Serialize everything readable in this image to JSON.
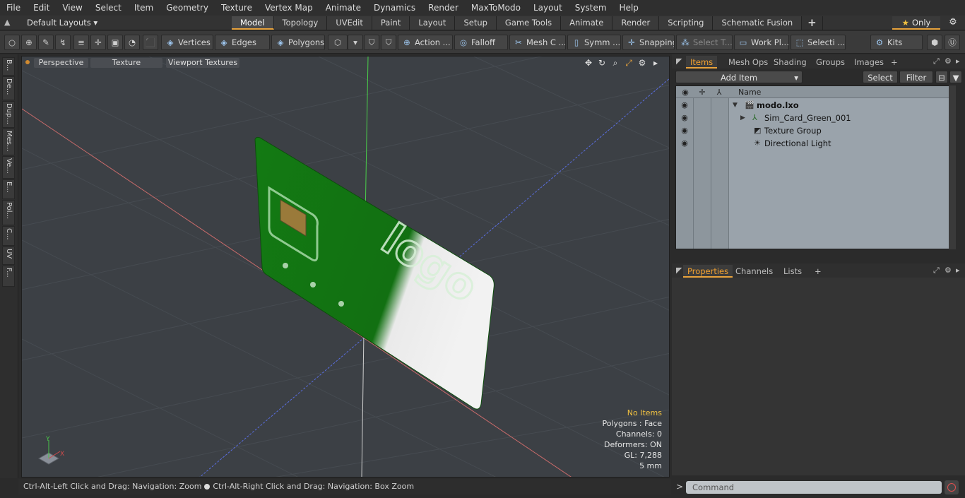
{
  "menu": [
    "File",
    "Edit",
    "View",
    "Select",
    "Item",
    "Geometry",
    "Texture",
    "Vertex Map",
    "Animate",
    "Dynamics",
    "Render",
    "MaxToModo",
    "Layout",
    "System",
    "Help"
  ],
  "layout": {
    "selector": "Default Layouts ▾",
    "tabs": [
      "Model",
      "Topology",
      "UVEdit",
      "Paint",
      "Layout",
      "Setup",
      "Game Tools",
      "Animate",
      "Render",
      "Scripting",
      "Schematic Fusion"
    ],
    "active_tab": "Model",
    "plus": "+",
    "only": "Only"
  },
  "toolbar": {
    "vertices": "Vertices",
    "edges": "Edges",
    "polygons": "Polygons",
    "action": "Action ...",
    "falloff": "Falloff",
    "mesh": "Mesh C ...",
    "symm": "Symm ...",
    "snapping": "Snapping",
    "select_t": "Select T...",
    "work_pl": "Work Pl...",
    "selecti": "Selecti ...",
    "kits": "Kits"
  },
  "left_tabs": [
    "B...",
    "De...",
    "Dup...",
    "Mes...",
    "Ve...",
    "E...",
    "Pol...",
    "C...",
    "UV",
    "F..."
  ],
  "viewport": {
    "perspective": "Perspective",
    "texture": "Texture",
    "viewport_textures": "Viewport Textures",
    "card_logo": "logo",
    "info": {
      "no_items": "No Items",
      "polygons": "Polygons : Face",
      "channels": "Channels: 0",
      "deformers": "Deformers: ON",
      "gl": "GL: 7,288",
      "scale": "5 mm"
    },
    "axis_y": "Y",
    "axis_x": "X"
  },
  "status": {
    "left": "Ctrl-Alt-Left Click and Drag: Navigation: Zoom",
    "right": "Ctrl-Alt-Right Click and Drag: Navigation: Box Zoom"
  },
  "items_panel": {
    "tabs": [
      "Items",
      "Mesh Ops",
      "Shading",
      "Groups",
      "Images"
    ],
    "active": "Items",
    "plus": "+",
    "add_item": "Add Item",
    "select": "Select",
    "filter": "Filter",
    "col_name": "Name",
    "rows": [
      {
        "name": "modo.lxo",
        "icon": "scene-icon"
      },
      {
        "name": "Sim_Card_Green_001",
        "icon": "mesh-icon"
      },
      {
        "name": "Texture Group",
        "icon": "texture-group-icon"
      },
      {
        "name": "Directional Light",
        "icon": "light-icon"
      }
    ]
  },
  "props_panel": {
    "tabs": [
      "Properties",
      "Channels",
      "Lists"
    ],
    "active": "Properties",
    "plus": "+"
  },
  "command": {
    "placeholder": "Command",
    "prompt": ">"
  },
  "colors": {
    "accent": "#e8a33c",
    "card_green": "#137a13",
    "viewport_bg": "#3c4045"
  }
}
